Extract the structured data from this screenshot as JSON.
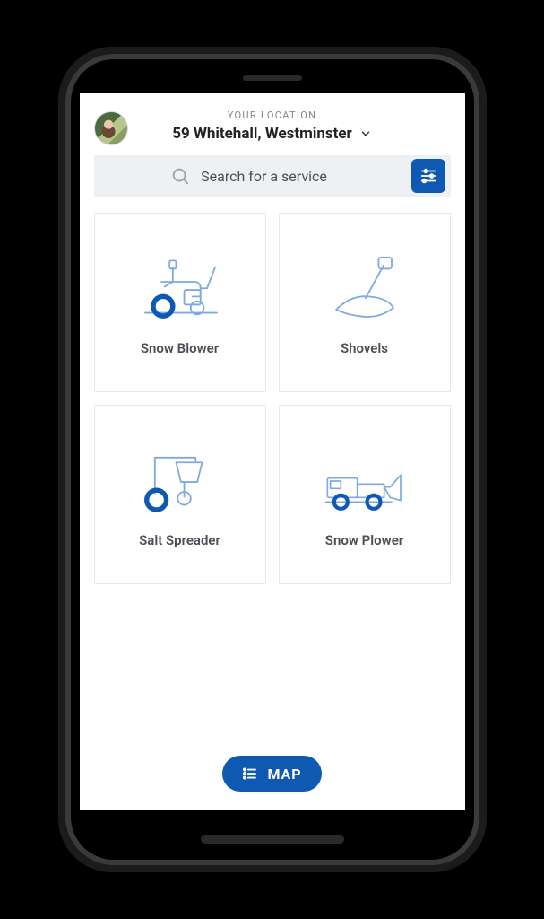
{
  "header": {
    "location_label": "YOUR LOCATION",
    "location_value": "59 Whitehall, Westminster"
  },
  "search": {
    "placeholder": "Search for a service"
  },
  "services": [
    {
      "id": "snow-blower",
      "label": "Snow Blower"
    },
    {
      "id": "shovels",
      "label": "Shovels"
    },
    {
      "id": "salt-spreader",
      "label": "Salt Spreader"
    },
    {
      "id": "snow-plower",
      "label": "Snow Plower"
    }
  ],
  "footer": {
    "map_label": "MAP"
  },
  "colors": {
    "accent": "#1059b3",
    "stroke_light": "#7fa9e0",
    "text_muted": "#7d8790",
    "text": "#4a4f55",
    "border": "#e6eaef",
    "search_bg": "#eef1f3"
  }
}
